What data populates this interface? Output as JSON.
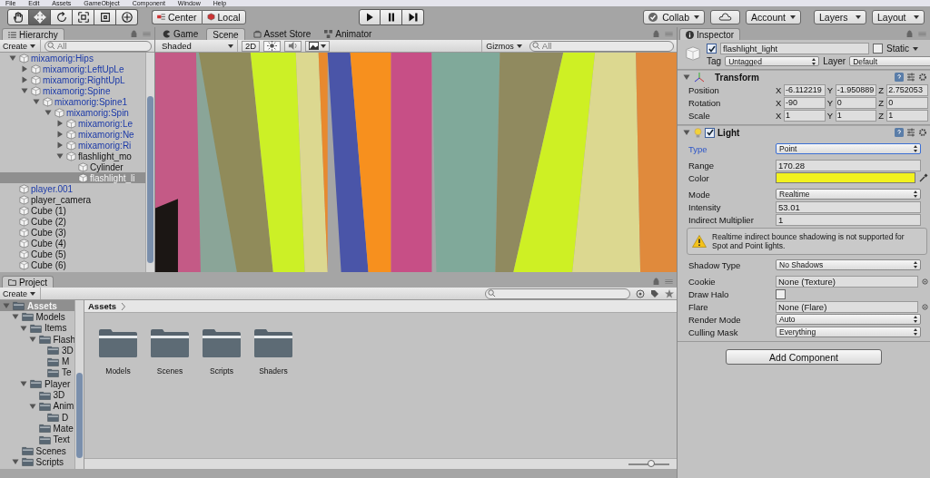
{
  "menu": [
    "File",
    "Edit",
    "Assets",
    "GameObject",
    "Component",
    "Window",
    "Help"
  ],
  "tools": [
    {
      "kind": "hand",
      "selected": false
    },
    {
      "kind": "move",
      "selected": true
    },
    {
      "kind": "rotate",
      "selected": false
    },
    {
      "kind": "scale",
      "selected": false
    },
    {
      "kind": "rect",
      "selected": false
    },
    {
      "kind": "transform",
      "selected": false
    }
  ],
  "pivot": [
    {
      "kind": "pivot",
      "label": "Center"
    },
    {
      "kind": "space",
      "label": "Local"
    }
  ],
  "playback": [
    {
      "kind": "play"
    },
    {
      "kind": "pause"
    },
    {
      "kind": "step"
    }
  ],
  "account_bar": {
    "collab": "Collab",
    "account": "Account",
    "layers": "Layers",
    "layout": "Layout"
  },
  "hierarchy": {
    "tab": "Hierarchy",
    "create": "Create",
    "search_placeholder": "All",
    "items": [
      {
        "label": "mixamorig:Hips",
        "prefab": true,
        "selected": false,
        "expanded": true,
        "children": [
          {
            "label": "mixamorig:LeftUpLe",
            "prefab": true,
            "selected": false,
            "expanded": false
          },
          {
            "label": "mixamorig:RightUpL",
            "prefab": true,
            "selected": false,
            "expanded": false
          },
          {
            "label": "mixamorig:Spine",
            "prefab": true,
            "selected": false,
            "expanded": true,
            "children": [
              {
                "label": "mixamorig:Spine1",
                "prefab": true,
                "selected": false,
                "expanded": true,
                "children": [
                  {
                    "label": "mixamorig:Spin",
                    "prefab": true,
                    "selected": false,
                    "expanded": true,
                    "children": [
                      {
                        "label": "mixamorig:Le",
                        "prefab": true,
                        "selected": false,
                        "expanded": false
                      },
                      {
                        "label": "mixamorig:Ne",
                        "prefab": true,
                        "selected": false,
                        "expanded": false
                      },
                      {
                        "label": "mixamorig:Ri",
                        "prefab": true,
                        "selected": false,
                        "expanded": false
                      },
                      {
                        "label": "flashlight_mo",
                        "prefab": false,
                        "selected": false,
                        "expanded": true,
                        "children": [
                          {
                            "label": "Cylinder",
                            "prefab": false,
                            "selected": false
                          },
                          {
                            "label": "flashlight_li",
                            "prefab": false,
                            "selected": true
                          }
                        ]
                      }
                    ]
                  }
                ]
              }
            ]
          }
        ]
      },
      {
        "label": "player.001",
        "prefab": true,
        "selected": false
      },
      {
        "label": "player_camera",
        "prefab": false,
        "selected": false
      },
      {
        "label": "Cube (1)",
        "prefab": false,
        "selected": false
      },
      {
        "label": "Cube (2)",
        "prefab": false,
        "selected": false
      },
      {
        "label": "Cube (3)",
        "prefab": false,
        "selected": false
      },
      {
        "label": "Cube (4)",
        "prefab": false,
        "selected": false
      },
      {
        "label": "Cube (5)",
        "prefab": false,
        "selected": false
      },
      {
        "label": "Cube (6)",
        "prefab": false,
        "selected": false
      }
    ]
  },
  "scene_tabs": [
    {
      "kind": "game",
      "label": "Game",
      "selected": false
    },
    {
      "kind": "scene",
      "label": "Scene",
      "selected": true
    },
    {
      "kind": "store",
      "label": "Asset Store",
      "selected": false
    },
    {
      "kind": "animator",
      "label": "Animator",
      "selected": false
    }
  ],
  "scene_toolbar": {
    "shading": "Shaded",
    "mode_2d": "2D",
    "lighting": true,
    "audio": false,
    "gizmos": "Gizmos",
    "search_placeholder": "All"
  },
  "inspector": {
    "tab": "Inspector",
    "object": {
      "active": true,
      "name": "flashlight_light",
      "static_label": "Static",
      "static": false,
      "tag_label": "Tag",
      "tag": "Untagged",
      "layer_label": "Layer",
      "layer": "Default"
    },
    "transform": {
      "title": "Transform",
      "expanded": true,
      "rows": [
        {
          "label": "Position",
          "values": [
            {
              "axis": "X",
              "value": "-6.112219"
            },
            {
              "axis": "Y",
              "value": "-1.950889"
            },
            {
              "axis": "Z",
              "value": "2.752053"
            }
          ]
        },
        {
          "label": "Rotation",
          "values": [
            {
              "axis": "X",
              "value": "-90"
            },
            {
              "axis": "Y",
              "value": "0"
            },
            {
              "axis": "Z",
              "value": "0"
            }
          ]
        },
        {
          "label": "Scale",
          "values": [
            {
              "axis": "X",
              "value": "1"
            },
            {
              "axis": "Y",
              "value": "1"
            },
            {
              "axis": "Z",
              "value": "1"
            }
          ]
        }
      ]
    },
    "light": {
      "title": "Light",
      "enabled": true,
      "expanded": true,
      "sections": [
        {
          "rows": [
            {
              "kind": "dropdown",
              "label": "Type",
              "value": "Point",
              "focused": true
            }
          ]
        },
        {
          "rows": [
            {
              "kind": "number",
              "label": "Range",
              "value": "170.28"
            },
            {
              "kind": "color",
              "label": "Color",
              "color": "#f2f21e"
            }
          ]
        },
        {
          "rows": [
            {
              "kind": "dropdown",
              "label": "Mode",
              "value": "Realtime",
              "focused": false
            },
            {
              "kind": "number",
              "label": "Intensity",
              "value": "53.01"
            },
            {
              "kind": "number",
              "label": "Indirect Multiplier",
              "value": "1"
            },
            {
              "kind": "help",
              "text": "Realtime indirect bounce shadowing is not supported for Spot and Point lights."
            }
          ]
        },
        {
          "rows": [
            {
              "kind": "dropdown",
              "label": "Shadow Type",
              "value": "No Shadows",
              "focused": false
            }
          ]
        },
        {
          "rows": [
            {
              "kind": "object",
              "label": "Cookie",
              "value": "None (Texture)"
            },
            {
              "kind": "checkbox",
              "label": "Draw Halo",
              "checked": false
            },
            {
              "kind": "object",
              "label": "Flare",
              "value": "None (Flare)"
            },
            {
              "kind": "dropdown",
              "label": "Render Mode",
              "value": "Auto",
              "focused": false
            },
            {
              "kind": "dropdown",
              "label": "Culling Mask",
              "value": "Everything",
              "focused": false
            }
          ]
        }
      ]
    },
    "add_component": "Add Component"
  },
  "project": {
    "tab": "Project",
    "create": "Create",
    "breadcrumb": "Assets",
    "tree": [
      {
        "label": "Assets",
        "selected": true,
        "expanded": true,
        "children": [
          {
            "label": "Models",
            "selected": false,
            "expanded": true,
            "children": [
              {
                "label": "Items",
                "selected": false,
                "expanded": true,
                "children": [
                  {
                    "label": "Flash",
                    "selected": false,
                    "expanded": true,
                    "children": [
                      {
                        "label": "3D",
                        "selected": false
                      },
                      {
                        "label": "M",
                        "selected": false
                      },
                      {
                        "label": "Te",
                        "selected": false
                      }
                    ]
                  }
                ]
              },
              {
                "label": "Player",
                "selected": false,
                "expanded": true,
                "children": [
                  {
                    "label": "3D",
                    "selected": false
                  },
                  {
                    "label": "Anim",
                    "selected": false,
                    "expanded": true,
                    "children": [
                      {
                        "label": "D",
                        "selected": false
                      }
                    ]
                  },
                  {
                    "label": "Mate",
                    "selected": false
                  },
                  {
                    "label": "Text",
                    "selected": false
                  }
                ]
              }
            ]
          },
          {
            "label": "Scenes",
            "selected": false
          },
          {
            "label": "Scripts",
            "selected": false,
            "expanded": true
          }
        ]
      }
    ],
    "folders": [
      {
        "label": "Models"
      },
      {
        "label": "Scenes"
      },
      {
        "label": "Scripts"
      },
      {
        "label": "Shaders"
      }
    ],
    "thumbnail_slider": {
      "level": 0.55
    }
  }
}
